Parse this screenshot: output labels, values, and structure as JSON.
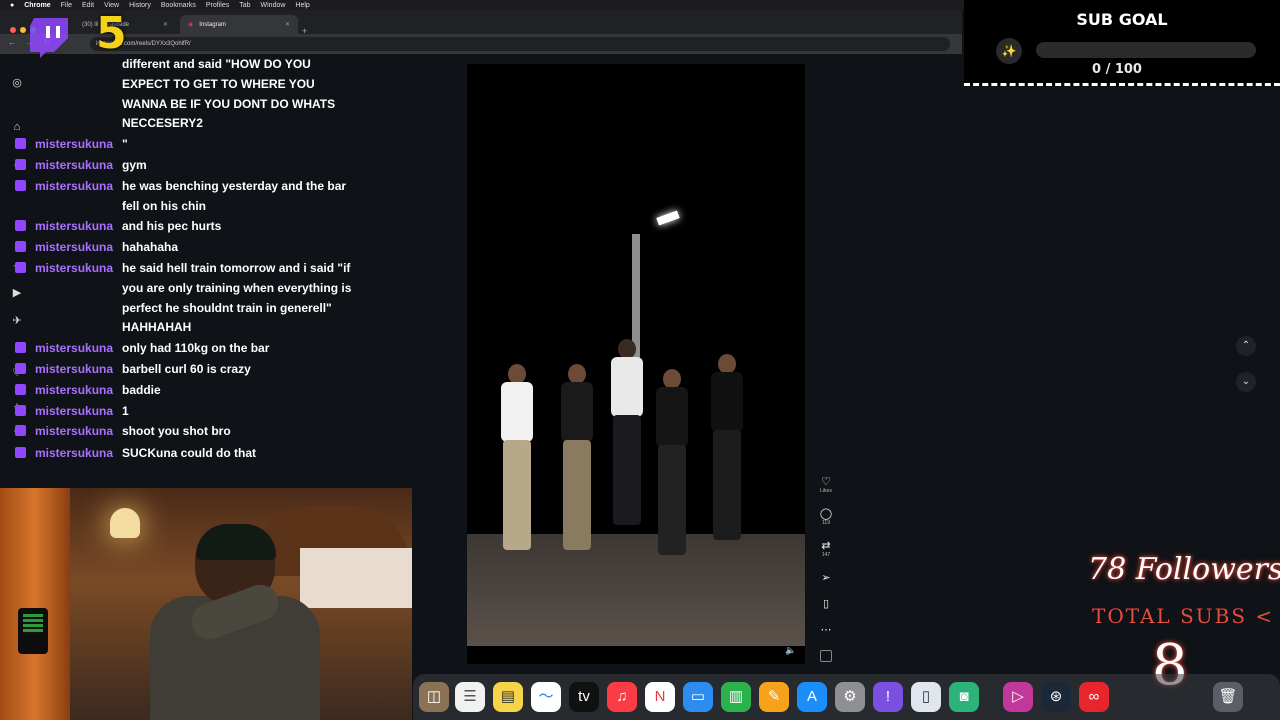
{
  "menubar": {
    "apple": "",
    "app": "Chrome",
    "items": [
      "File",
      "Edit",
      "View",
      "History",
      "Bookmarks",
      "Profiles",
      "Tab",
      "Window",
      "Help"
    ]
  },
  "browser": {
    "tabs": [
      {
        "label": "(30) lil ... eastside"
      },
      {
        "label": "Instagram"
      }
    ],
    "url": "instagram.com/reels/DYXx3QohlfR/"
  },
  "twitch_overlay": {
    "sub_number": "5"
  },
  "chat": {
    "first_lines": [
      "different and said \"HOW DO YOU",
      "EXPECT TO GET TO WHERE YOU",
      "WANNA BE IF YOU DONT DO WHATS",
      "NECCESERY2"
    ],
    "messages": [
      {
        "user": "mistersukuna",
        "lines": [
          "\""
        ]
      },
      {
        "user": "mistersukuna",
        "lines": [
          "gym"
        ]
      },
      {
        "user": "mistersukuna",
        "lines": [
          "he was benching yesterday and the bar",
          "fell on his chin"
        ]
      },
      {
        "user": "mistersukuna",
        "lines": [
          "and his pec hurts"
        ]
      },
      {
        "user": "mistersukuna",
        "lines": [
          "hahahaha"
        ]
      },
      {
        "user": "mistersukuna",
        "lines": [
          "he said hell train tomorrow and i said \"if",
          "you are only training when everything is",
          "perfect he shouldnt train in generell\"",
          "HAHHAHAH"
        ]
      },
      {
        "user": "mistersukuna",
        "lines": [
          "only had 110kg on the bar"
        ]
      },
      {
        "user": "mistersukuna",
        "lines": [
          "barbell curl 60 is crazy"
        ]
      },
      {
        "user": "mistersukuna",
        "lines": [
          "baddie"
        ]
      },
      {
        "user": "mistersukuna",
        "lines": [
          "1"
        ]
      },
      {
        "user": "mistersukuna",
        "lines": [
          "shoot you shot bro"
        ]
      },
      {
        "user": "mistersukuna",
        "lines": [
          "SUCKuna could do that"
        ]
      }
    ]
  },
  "reel": {
    "actions": [
      {
        "icon": "heart-icon",
        "glyph": "♡",
        "count": "Likes"
      },
      {
        "icon": "comment-icon",
        "glyph": "◯",
        "count": "119"
      },
      {
        "icon": "repost-icon",
        "glyph": "⇄",
        "count": "147"
      },
      {
        "icon": "share-icon",
        "glyph": "➢",
        "count": ""
      },
      {
        "icon": "save-icon",
        "glyph": "▯",
        "count": ""
      },
      {
        "icon": "more-icon",
        "glyph": "⋯",
        "count": ""
      }
    ],
    "mute_glyph": "🔈"
  },
  "sub_goal": {
    "title": "SUB GOAL",
    "current": 0,
    "target": 100,
    "count_text": "0 / 100",
    "progress": 0
  },
  "followers_overlay": {
    "followers": "78 Followers",
    "total_subs": "TOTAL SUBS <",
    "total_subs_value": "8"
  },
  "colors": {
    "twitch_purple": "#9146ff",
    "chat_username": "#a970ff",
    "accent_yellow": "#f5d21a"
  }
}
